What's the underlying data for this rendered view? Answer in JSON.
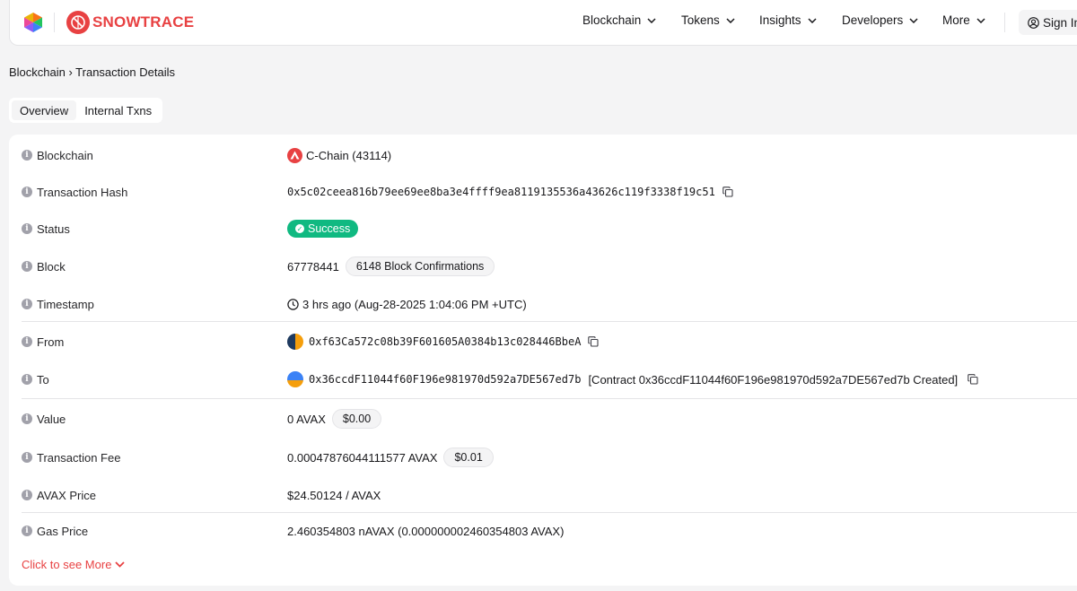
{
  "nav": {
    "brand": "SNOWTRACE",
    "items": [
      {
        "label": "Blockchain"
      },
      {
        "label": "Tokens"
      },
      {
        "label": "Insights"
      },
      {
        "label": "Developers"
      },
      {
        "label": "More"
      }
    ],
    "signin": "Sign In"
  },
  "breadcrumb": "Blockchain › Transaction Details",
  "tabs": [
    {
      "label": "Overview",
      "active": true
    },
    {
      "label": "Internal Txns",
      "active": false
    }
  ],
  "details": {
    "blockchain": {
      "label": "Blockchain",
      "value": "C-Chain (43114)"
    },
    "tx_hash": {
      "label": "Transaction Hash",
      "value": "0x5c02ceea816b79ee69ee8ba3e4ffff9ea8119135536a43626c119f3338f19c51"
    },
    "status": {
      "label": "Status",
      "value": "Success"
    },
    "block": {
      "label": "Block",
      "value": "67778441",
      "confirmations": "6148 Block Confirmations"
    },
    "timestamp": {
      "label": "Timestamp",
      "value": "3 hrs ago (Aug-28-2025 1:04:06 PM +UTC)"
    },
    "from": {
      "label": "From",
      "value": "0xf63Ca572c08b39F601605A0384b13c028446BbeA"
    },
    "to": {
      "label": "To",
      "value": "0x36ccdF11044f60F196e981970d592a7DE567ed7b",
      "contract_note": "[Contract 0x36ccdF11044f60F196e981970d592a7DE567ed7b Created]"
    },
    "value": {
      "label": "Value",
      "value": "0 AVAX",
      "usd": "$0.00"
    },
    "fee": {
      "label": "Transaction Fee",
      "value": "0.00047876044111577 AVAX",
      "usd": "$0.01"
    },
    "avax_price": {
      "label": "AVAX Price",
      "value": "$24.50124 / AVAX"
    },
    "gas_price": {
      "label": "Gas Price",
      "value": "2.460354803 nAVAX (0.000000002460354803 AVAX)"
    }
  },
  "see_more": "Click to see More",
  "colors": {
    "accent": "#e84142",
    "success": "#10b981"
  }
}
